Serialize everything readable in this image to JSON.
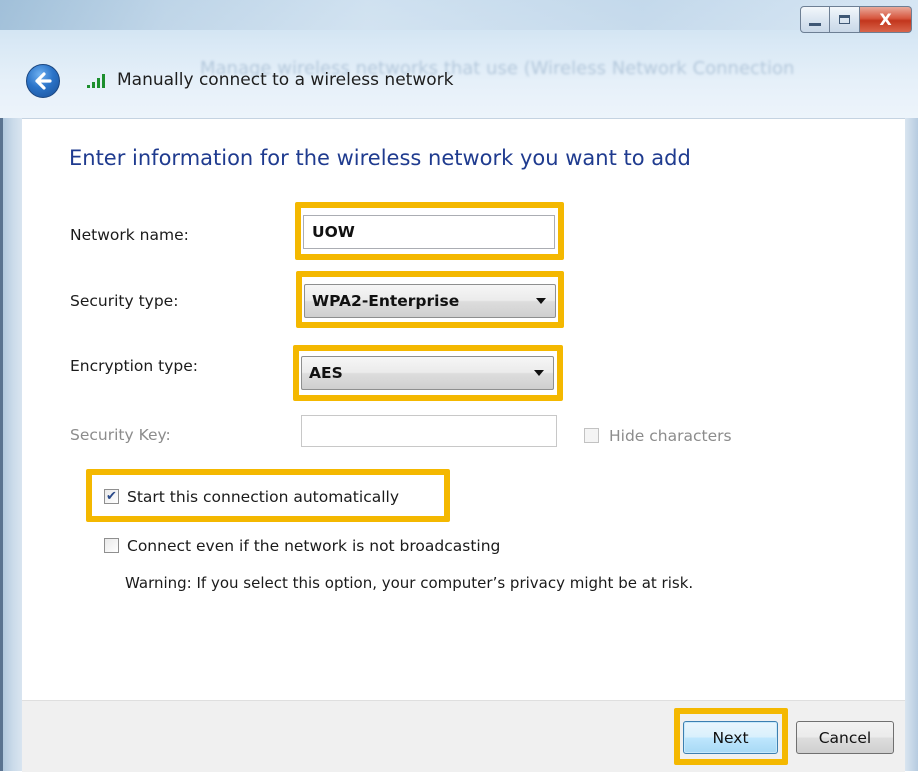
{
  "window": {
    "title": "Manually connect to a wireless network",
    "background_text": "Manage wireless networks that use (Wireless Network Connection",
    "caption": {
      "close_label": "X"
    }
  },
  "main": {
    "heading": "Enter information for the wireless network you want to add",
    "network_name": {
      "label": "Network name:",
      "value": "UOW"
    },
    "security_type": {
      "label": "Security type:",
      "value": "WPA2-Enterprise"
    },
    "encryption_type": {
      "label": "Encryption type:",
      "value": "AES"
    },
    "security_key": {
      "label": "Security Key:",
      "value": "",
      "hide_label": "Hide characters",
      "hide_checked": false,
      "disabled": true
    },
    "auto_start": {
      "label": "Start this connection automatically",
      "checked": true
    },
    "broadcast": {
      "label": "Connect even if the network is not broadcasting",
      "checked": false
    },
    "warning": "Warning: If you select this option, your computer’s privacy might be at risk."
  },
  "footer": {
    "next_label": "Next",
    "cancel_label": "Cancel"
  },
  "colors": {
    "highlight": "#f4b800",
    "heading": "#1f3b8f",
    "accent": "#2b74c9"
  }
}
